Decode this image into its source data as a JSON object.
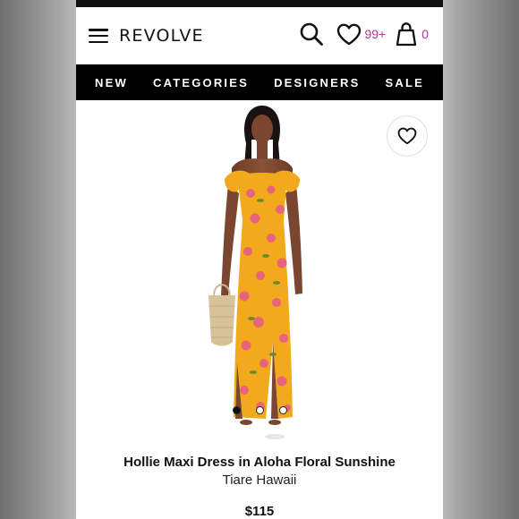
{
  "header": {
    "logo": "REVOLVE",
    "wishlist_count": "99+",
    "bag_count": "0"
  },
  "nav": {
    "items": [
      {
        "label": "NEW"
      },
      {
        "label": "CATEGORIES"
      },
      {
        "label": "DESIGNERS"
      },
      {
        "label": "SALE"
      }
    ]
  },
  "product": {
    "name": "Hollie Maxi Dress in Aloha Floral Sunshine",
    "brand": "Tiare Hawaii",
    "price": "$115",
    "image_count": 3,
    "active_image": 1
  },
  "colors": {
    "accent": "#b5359a",
    "dress": "#f2a91c",
    "nav_bg": "#000000"
  },
  "icons": [
    "menu-icon",
    "search-icon",
    "heart-icon",
    "bag-icon",
    "favorite-heart-icon"
  ]
}
